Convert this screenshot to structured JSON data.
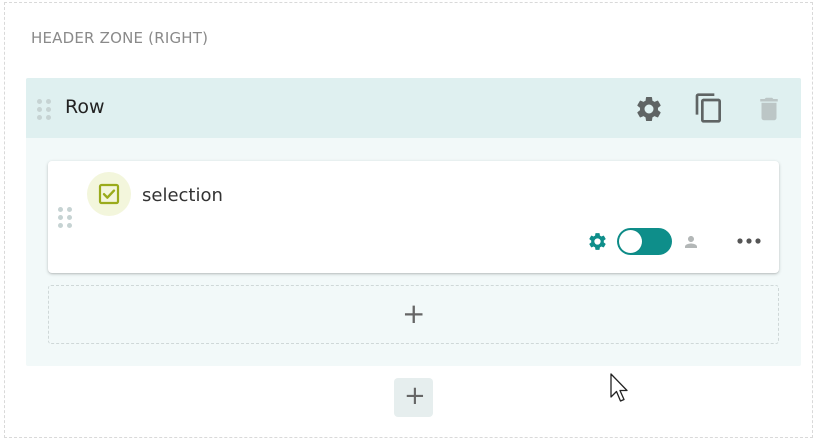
{
  "zone": {
    "title": "HEADER ZONE (RIGHT)"
  },
  "row": {
    "title": "Row",
    "actions": [
      "gear-icon",
      "copy-icon",
      "trash-icon"
    ]
  },
  "card": {
    "label": "selection",
    "type_icon": "checkbox-icon",
    "toggle_on": true,
    "actions": [
      "gear-icon",
      "user-icon",
      "more-icon"
    ]
  },
  "add": {
    "symbol": "+"
  },
  "colors": {
    "teal": "#0e8e8a",
    "row_header": "#dff0f0",
    "row_body": "#f2f9f9",
    "badge_bg": "#f3f6dc",
    "badge_fg": "#9aab1c"
  }
}
